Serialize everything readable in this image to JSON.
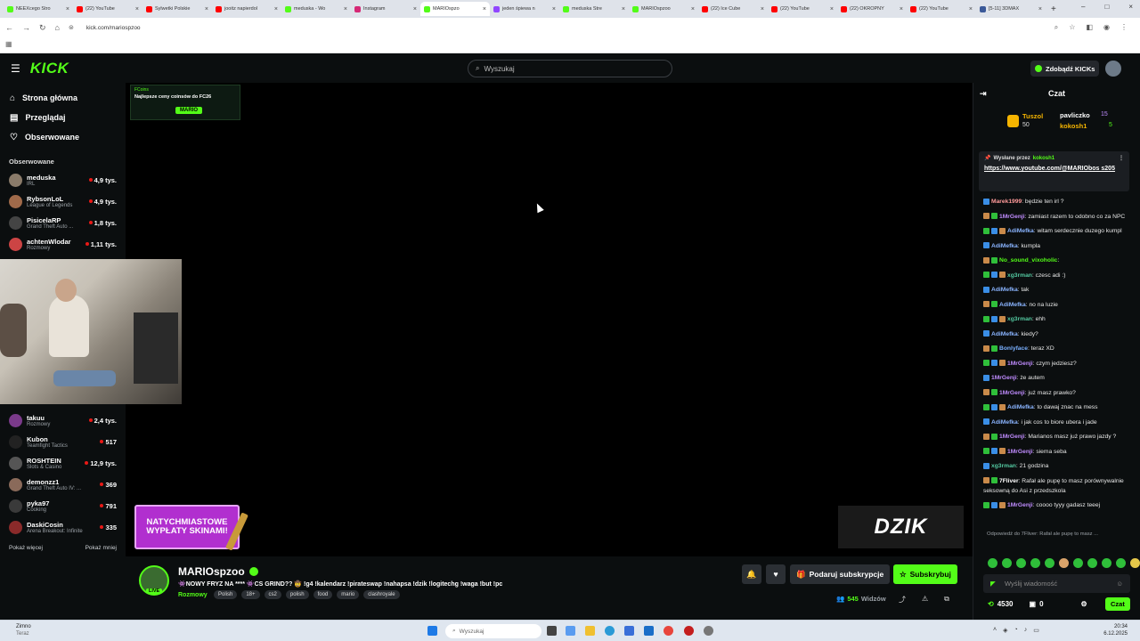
{
  "browser": {
    "tabs": [
      {
        "title": "NEEXcego Stro",
        "color": "#53fc18"
      },
      {
        "title": "(22) YouTube",
        "color": "#ff0000"
      },
      {
        "title": "Sylwetki Polskie",
        "color": "#ff0000"
      },
      {
        "title": "jooitz napierdol",
        "color": "#ff0000"
      },
      {
        "title": "meduska - Wo",
        "color": "#53fc18"
      },
      {
        "title": "Instagram",
        "color": "#d62976"
      },
      {
        "title": "MARIOspzo",
        "color": "#53fc18",
        "active": true
      },
      {
        "title": "jeden śpiewa n",
        "color": "#9146ff"
      },
      {
        "title": "meduska Stre",
        "color": "#53fc18"
      },
      {
        "title": "MARIOspzoo",
        "color": "#53fc18"
      },
      {
        "title": "(22) Ice Cube",
        "color": "#ff0000"
      },
      {
        "title": "(22) YouTube",
        "color": "#ff0000"
      },
      {
        "title": "(22) OKROPNY",
        "color": "#ff0000"
      },
      {
        "title": "(22) YouTube",
        "color": "#ff0000"
      },
      {
        "title": "[5-11] 3DMAX",
        "color": "#3b5998"
      }
    ],
    "url": "kick.com/mariospzoo"
  },
  "header": {
    "logo": "KICK",
    "search_placeholder": "Wyszukaj",
    "get_kicks": "Zdobądź KICKs"
  },
  "sidebar": {
    "nav": [
      {
        "label": "Strona główna",
        "icon": "home-icon"
      },
      {
        "label": "Przeglądaj",
        "icon": "browse-icon"
      },
      {
        "label": "Obserwowane",
        "icon": "heart-icon"
      }
    ],
    "section": "Obserwowane",
    "channels_top": [
      {
        "name": "meduska",
        "game": "IRL",
        "viewers": "4,9 tys.",
        "color": "#8a7b6a"
      },
      {
        "name": "RybsonLoL",
        "game": "League of Legends",
        "viewers": "4,9 tys.",
        "color": "#a06a4a"
      },
      {
        "name": "PisicelaRP",
        "game": "Grand Theft Auto ...",
        "viewers": "1,8 tys.",
        "color": "#444"
      },
      {
        "name": "achtenWlodar",
        "game": "Rozmowy",
        "viewers": "1,11 tys.",
        "color": "#c44"
      }
    ],
    "channels_bottom": [
      {
        "name": "takuu",
        "game": "Rozmowy",
        "viewers": "2,4 tys.",
        "color": "#7a3a8a"
      },
      {
        "name": "Kubon",
        "game": "Teamfight Tactics",
        "viewers": "517",
        "color": "#222"
      },
      {
        "name": "ROSHTEIN",
        "game": "Slots & Casino",
        "viewers": "12,9 tys.",
        "color": "#555"
      },
      {
        "name": "demonzz1",
        "game": "Grand Theft Auto IV: ...",
        "viewers": "369",
        "color": "#8a6a5a"
      },
      {
        "name": "pyka97",
        "game": "Cooking",
        "viewers": "791",
        "color": "#3a3a3a"
      },
      {
        "name": "DaskiCosin",
        "game": "Arena Breakout: Infinite",
        "viewers": "335",
        "color": "#8a2a2a"
      }
    ],
    "show_more": "Pokaż więcej",
    "show_less": "Pokaż mniej"
  },
  "player": {
    "ad_top_text": "Najlepsze ceny coinsów do FC26",
    "ad_top_brand": "MARIO",
    "sponsor_line1": "NATYCHMIASTOWE",
    "sponsor_line2": "WYPŁATY SKINAMI!",
    "dzik": "DZIK"
  },
  "stream": {
    "channel": "MARIOspzoo",
    "live": "LIVE",
    "title": "👾NOWY FRYZ NA **** 👾CS GRIND?? 🤠 !g4 !kalendarz !pirateswap !nahapsa !dzik !logitechg !waga !but !pc",
    "category": "Rozmowy",
    "tags": [
      "Polish",
      "18+",
      "cs2",
      "polish",
      "food",
      "mario",
      "clashroyale"
    ],
    "gift_sub": "Podaruj subskrypcje",
    "subscribe": "Subskrybuj",
    "viewers_count": "545",
    "viewers_label": "Widzów"
  },
  "chat": {
    "title": "Czat",
    "leader1": {
      "name": "Tuszol",
      "amount": "50"
    },
    "leader2": {
      "name": "pavliczko",
      "amount": "15"
    },
    "leader3": {
      "name": "kokosh1",
      "amount": "5"
    },
    "pinned_by_label": "Wysłane przez",
    "pinned_by_user": "kokosh1",
    "pinned_link": "https://www.youtube.com/@MARIObos s205",
    "messages": [
      {
        "user": "Marek1999",
        "color": "#ff9a9a",
        "text": ": będzie ten irl ?"
      },
      {
        "user": "1MrGenji",
        "color": "#c08cff",
        "text": ": zamiast razem to odobno co za NPC"
      },
      {
        "user": "AdiMefka",
        "color": "#8ab4ff",
        "text": ": witam serdecznie duzego kumpl"
      },
      {
        "user": "AdiMefka",
        "color": "#8ab4ff",
        "text": ": kumpla"
      },
      {
        "user": "No_sound_vixoholic",
        "color": "#53fc18",
        "text": ":"
      },
      {
        "user": "xg3rman",
        "color": "#53c8a0",
        "text": ": czesc adi :)"
      },
      {
        "user": "AdiMefka",
        "color": "#8ab4ff",
        "text": ": tak"
      },
      {
        "user": "AdiMefka",
        "color": "#8ab4ff",
        "text": ": no na luzie"
      },
      {
        "user": "xg3rman",
        "color": "#53c8a0",
        "text": ": ehh"
      },
      {
        "user": "AdiMefka",
        "color": "#8ab4ff",
        "text": ": kiedy?"
      },
      {
        "user": "Bonlyface",
        "color": "#7ab0ff",
        "text": ": teraz XD"
      },
      {
        "user": "1MrGenji",
        "color": "#c08cff",
        "text": ": czym jedziesz?"
      },
      {
        "user": "1MrGenji",
        "color": "#c08cff",
        "text": ": że autem"
      },
      {
        "user": "1MrGenji",
        "color": "#c08cff",
        "text": ": już masz prawko?"
      },
      {
        "user": "AdiMefka",
        "color": "#8ab4ff",
        "text": ": to dawaj znac na mess"
      },
      {
        "user": "AdiMefka",
        "color": "#8ab4ff",
        "text": ": i jak cos to biore ubera i jade"
      },
      {
        "user": "1MrGenji",
        "color": "#c08cff",
        "text": ": Marianos masz już prawo jazdy ?"
      },
      {
        "user": "1MrGenji",
        "color": "#c08cff",
        "text": ": siema seba"
      },
      {
        "user": "xg3rman",
        "color": "#53c8a0",
        "text": ": 21 godzina"
      },
      {
        "user": "7Fliver",
        "color": "#ffffff",
        "text": ": Rafał ale pupę to masz porównywalnie seksowną do Asi z przedszkola"
      },
      {
        "user": "1MrGenji",
        "color": "#c08cff",
        "text": ": coooo tyyy gadasz teeej"
      }
    ],
    "reply_hint": "Odpowiedź do 7Fliver: Rafał ale pupę to masz ...",
    "input_placeholder": "Wyślij wiadomość",
    "points": "4530",
    "gifts": "0",
    "send": "Czat"
  },
  "taskbar": {
    "weather_temp": "Zimno",
    "weather_sub": "Teraz",
    "search": "Wyszukaj",
    "time": "20:34",
    "date": "6.12.2025"
  }
}
